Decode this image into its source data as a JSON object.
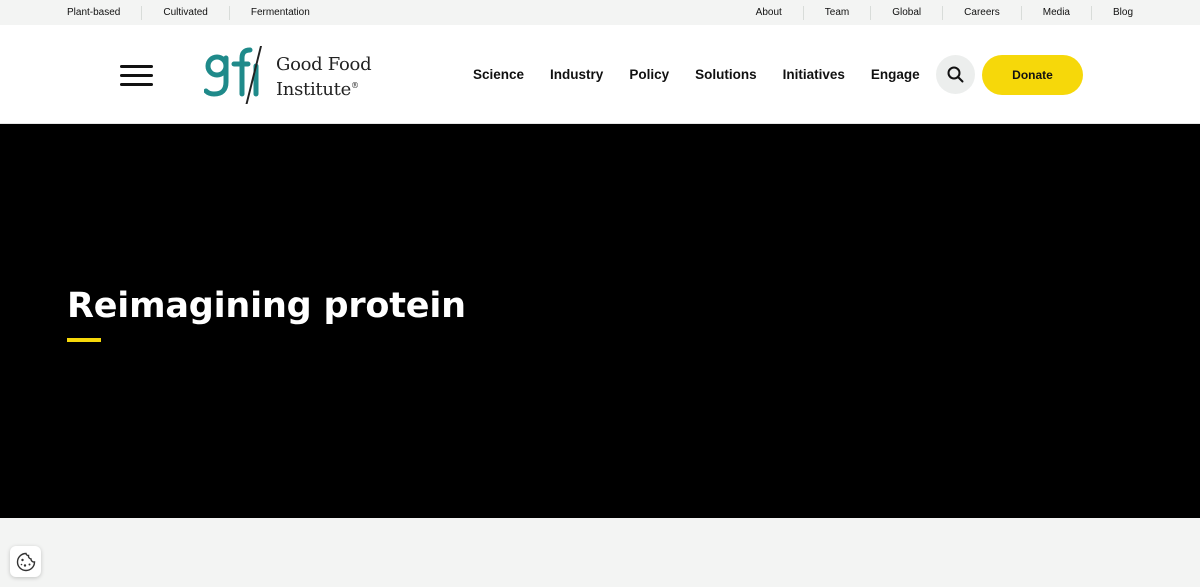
{
  "utility_nav": {
    "left": [
      "Plant-based",
      "Cultivated",
      "Fermentation"
    ],
    "right": [
      "About",
      "Team",
      "Global",
      "Careers",
      "Media",
      "Blog"
    ]
  },
  "header": {
    "logo": {
      "mark": "gfi",
      "line1": "Good Food",
      "line2": "Institute",
      "registered": "®"
    },
    "nav": [
      "Science",
      "Industry",
      "Policy",
      "Solutions",
      "Initiatives",
      "Engage"
    ],
    "donate_label": "Donate",
    "search_icon": "search-icon",
    "menu_icon": "hamburger-menu-icon"
  },
  "hero": {
    "title": "Reimagining protein"
  },
  "colors": {
    "accent_yellow": "#f6d80a",
    "logo_teal": "#1f8a8a",
    "hero_bg": "#000000"
  },
  "cookie_icon": "cookie-icon"
}
